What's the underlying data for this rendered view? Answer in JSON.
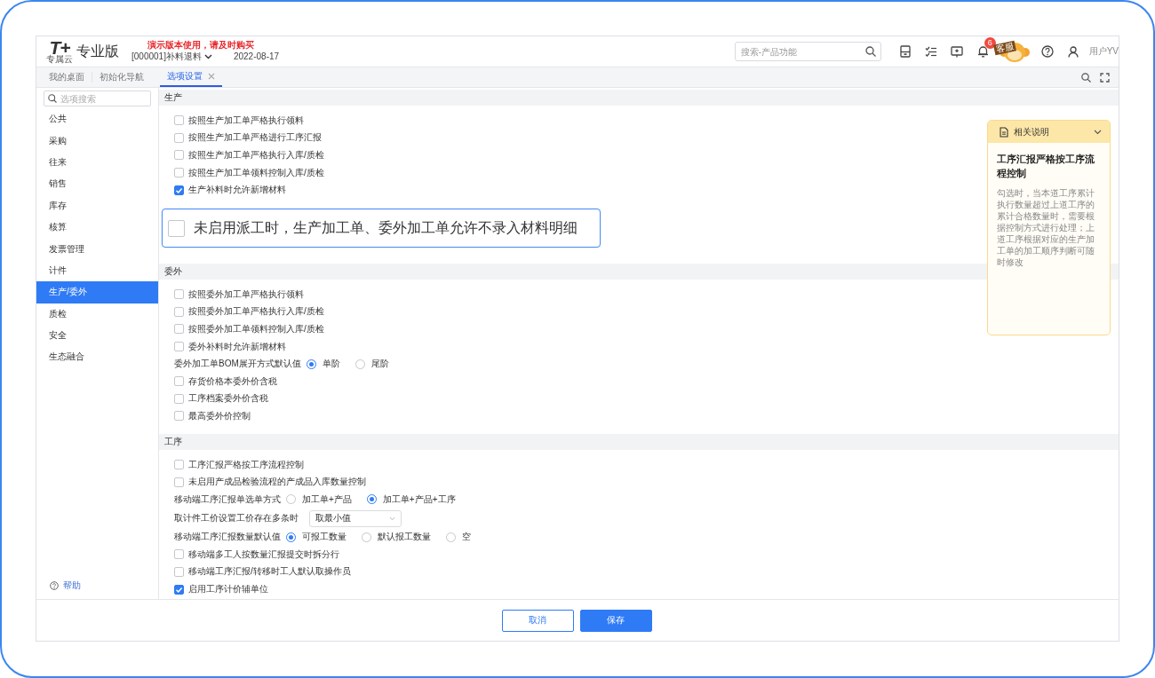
{
  "header": {
    "logo": "T+",
    "logo_sub": "专属云",
    "edition": "专业版",
    "notice": "演示版本使用，请及时购买",
    "account": "[000001]补料退料",
    "date": "2022-08-17",
    "search": {
      "placeholder": "搜索-产品功能"
    },
    "notification_count": "6",
    "service_label": "客服",
    "user": "用户YV"
  },
  "tabs": [
    {
      "label": "我的桌面",
      "selected": false,
      "closable": false
    },
    {
      "label": "初始化导航",
      "selected": false,
      "closable": false
    },
    {
      "label": "选项设置",
      "selected": true,
      "closable": true
    }
  ],
  "sidebar": {
    "search": {
      "placeholder": "选项搜索"
    },
    "items": [
      {
        "label": "公共",
        "selected": false
      },
      {
        "label": "采购",
        "selected": false
      },
      {
        "label": "往来",
        "selected": false
      },
      {
        "label": "销售",
        "selected": false
      },
      {
        "label": "库存",
        "selected": false
      },
      {
        "label": "核算",
        "selected": false
      },
      {
        "label": "发票管理",
        "selected": false
      },
      {
        "label": "计件",
        "selected": false
      },
      {
        "label": "生产/委外",
        "selected": true
      },
      {
        "label": "质检",
        "selected": false
      },
      {
        "label": "安全",
        "selected": false
      },
      {
        "label": "生态融合",
        "selected": false
      }
    ],
    "help": "帮助"
  },
  "sections": [
    {
      "title": "生产",
      "items": [
        {
          "kind": "checkbox",
          "label": "按照生产加工单严格执行领料",
          "checked": false
        },
        {
          "kind": "checkbox",
          "label": "按照生产加工单严格进行工序汇报",
          "checked": false
        },
        {
          "kind": "checkbox",
          "label": "按照生产加工单严格执行入库/质检",
          "checked": false
        },
        {
          "kind": "checkbox",
          "label": "按照生产加工单领料控制入库/质检",
          "checked": false
        },
        {
          "kind": "checkbox",
          "label": "生产补料时允许新增材料",
          "checked": true
        }
      ]
    },
    {
      "title": "委外",
      "items": [
        {
          "kind": "checkbox",
          "label": "按照委外加工单严格执行领料",
          "checked": false
        },
        {
          "kind": "checkbox",
          "label": "按照委外加工单严格执行入库/质检",
          "checked": false
        },
        {
          "kind": "checkbox",
          "label": "按照委外加工单领料控制入库/质检",
          "checked": false
        },
        {
          "kind": "checkbox",
          "label": "委外补料时允许新增材料",
          "checked": false
        },
        {
          "kind": "radio",
          "label": "委外加工单BOM展开方式默认值",
          "options": [
            {
              "label": "单阶",
              "selected": true
            },
            {
              "label": "尾阶",
              "selected": false
            }
          ]
        },
        {
          "kind": "checkbox",
          "label": "存货价格本委外价含税",
          "checked": false
        },
        {
          "kind": "checkbox",
          "label": "工序档案委外价含税",
          "checked": false
        },
        {
          "kind": "checkbox",
          "label": "最高委外价控制",
          "checked": false
        }
      ]
    },
    {
      "title": "工序",
      "items": [
        {
          "kind": "checkbox",
          "label": "工序汇报严格按工序流程控制",
          "checked": false
        },
        {
          "kind": "checkbox",
          "label": "未启用产成品检验流程的产成品入库数量控制",
          "checked": false
        },
        {
          "kind": "radio",
          "label": "移动端工序汇报单选单方式",
          "options": [
            {
              "label": "加工单+产品",
              "selected": false
            },
            {
              "label": "加工单+产品+工序",
              "selected": true
            }
          ]
        },
        {
          "kind": "select",
          "label": "取计件工价设置工价存在多条时",
          "value": "取最小值"
        },
        {
          "kind": "radio",
          "label": "移动端工序汇报数量默认值",
          "options": [
            {
              "label": "可报工数量",
              "selected": true
            },
            {
              "label": "默认报工数量",
              "selected": false
            },
            {
              "label": "空",
              "selected": false
            }
          ]
        },
        {
          "kind": "checkbox",
          "label": "移动端多工人按数量汇报提交时拆分行",
          "checked": false
        },
        {
          "kind": "checkbox",
          "label": "移动端工序汇报/转移时工人默认取操作员",
          "checked": false
        },
        {
          "kind": "checkbox",
          "label": "启用工序计价辅单位",
          "checked": true
        }
      ]
    }
  ],
  "callout": {
    "label": "未启用派工时，生产加工单、委外加工单允许不录入材料明细",
    "checked": false
  },
  "note": {
    "title": "相关说明",
    "heading": "工序汇报严格按工序流程控制",
    "body": "勾选时，当本道工序累计执行数量超过上道工序的累计合格数量时，需要根据控制方式进行处理；上道工序根据对应的生产加工单的加工顺序判断可随时修改"
  },
  "buttons": [
    {
      "label": "取消",
      "kind": "secondary"
    },
    {
      "label": "保存",
      "kind": "primary"
    }
  ]
}
